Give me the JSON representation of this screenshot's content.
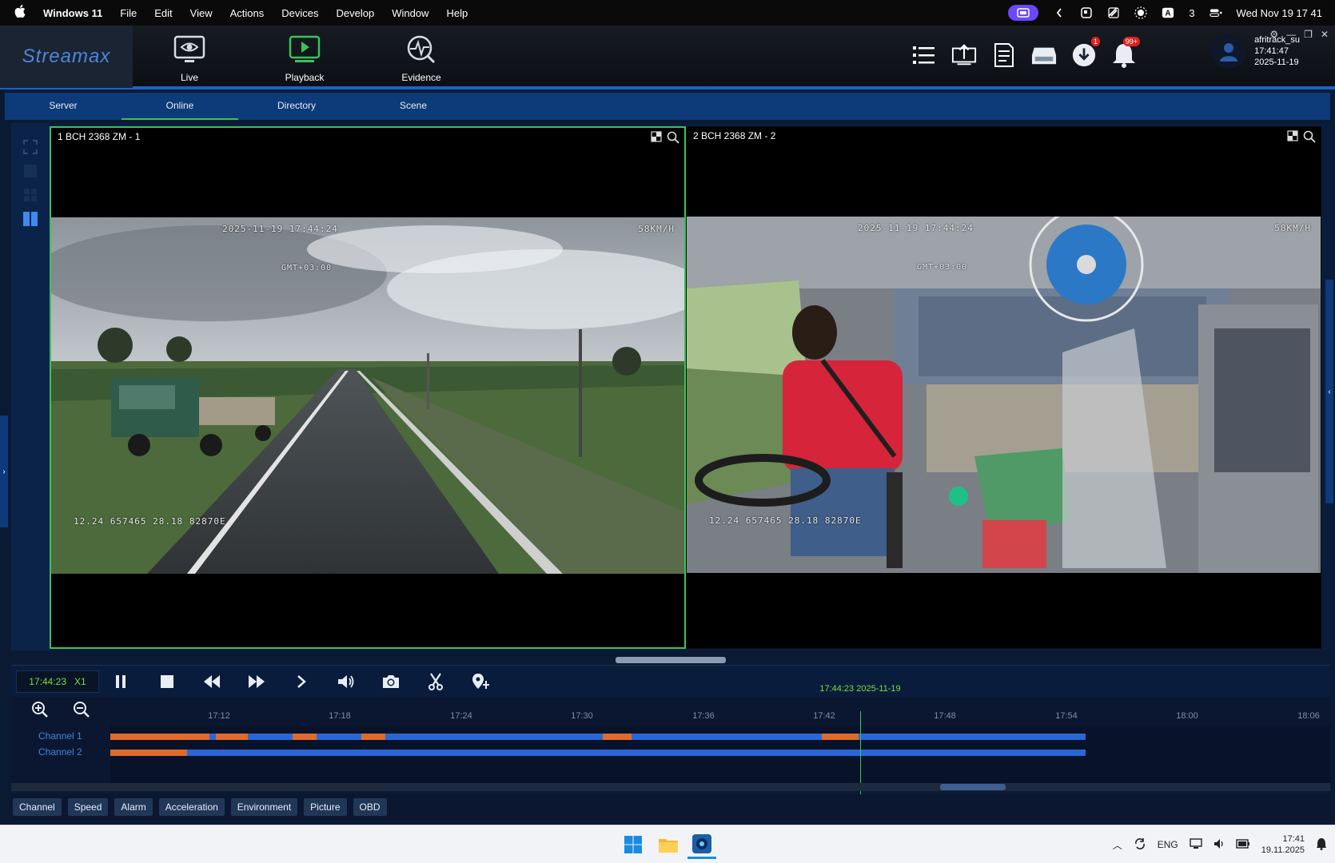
{
  "menubar": {
    "app_name": "Windows 11",
    "items": [
      "File",
      "Edit",
      "View",
      "Actions",
      "Devices",
      "Develop",
      "Window",
      "Help"
    ],
    "tray_num": "3",
    "datetime": "Wed Nov 19  17 41"
  },
  "appbar": {
    "logo": "Streamax",
    "nav": [
      {
        "label": "Live"
      },
      {
        "label": "Playback"
      },
      {
        "label": "Evidence"
      }
    ],
    "badges": {
      "download": "1",
      "alarm": "99+"
    },
    "user": {
      "name": "afritrack_su",
      "time": "17:41:47",
      "date": "2025-11-19"
    }
  },
  "tabs": [
    "Server",
    "Online",
    "Directory",
    "Scene"
  ],
  "videos": [
    {
      "title": "1 BCH 2368 ZM - 1",
      "osd_datetime": "2025-11-19  17:44:24",
      "osd_tz": "GMT+03:00",
      "osd_speed": "58KM/H",
      "osd_gps": "12.24 657465 28.18 82870E"
    },
    {
      "title": "2 BCH 2368 ZM - 2",
      "osd_datetime": "2025-11-19  17:44:24",
      "osd_tz": "GMT+03:00",
      "osd_speed": "58KM/H",
      "osd_gps": "12.24 657465 28.18 82870E"
    }
  ],
  "controls": {
    "time": "17:44:23",
    "speed": "X1"
  },
  "timeline": {
    "ticks": [
      "17:12",
      "17:18",
      "17:24",
      "17:30",
      "17:36",
      "17:42",
      "17:48",
      "17:54",
      "18:00",
      "18:06"
    ],
    "playhead_label": "17:44:23 2025-11-19",
    "channels": [
      "Channel 1",
      "Channel 2"
    ]
  },
  "bottom_tabs": [
    "Channel",
    "Speed",
    "Alarm",
    "Acceleration",
    "Environment",
    "Picture",
    "OBD"
  ],
  "taskbar": {
    "lang": "ENG",
    "time": "17:41",
    "date": "19.11.2025"
  },
  "colors": {
    "accent_green": "#3ac25b",
    "accent_blue": "#1b63c6",
    "track_blue": "#2a67d6",
    "alarm_orange": "#e06a2c"
  }
}
